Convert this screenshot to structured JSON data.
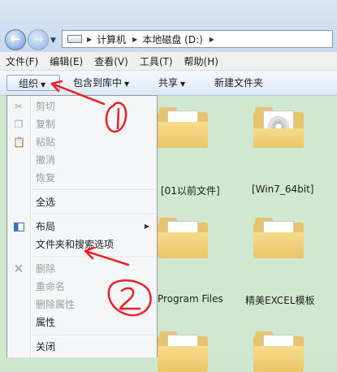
{
  "address": {
    "crumbs": [
      "计算机",
      "本地磁盘 (D:)"
    ]
  },
  "menubar": {
    "items": [
      "文件(F)",
      "编辑(E)",
      "查看(V)",
      "工具(T)",
      "帮助(H)"
    ]
  },
  "toolbar": {
    "organize": "组织",
    "include_library": "包含到库中",
    "share": "共享",
    "new_folder": "新建文件夹"
  },
  "dropdown": {
    "items": [
      {
        "label": "剪切",
        "icon": "scissors-icon",
        "disabled": true
      },
      {
        "label": "复制",
        "icon": "copy-icon",
        "disabled": true
      },
      {
        "label": "粘贴",
        "icon": "paste-icon",
        "disabled": true
      },
      {
        "label": "撤消",
        "disabled": true
      },
      {
        "label": "恢复",
        "disabled": true
      },
      {
        "label": "全选",
        "disabled": false
      },
      {
        "label": "布局",
        "icon": "layout-icon",
        "disabled": false,
        "submenu": true
      },
      {
        "label": "文件夹和搜索选项",
        "disabled": false
      },
      {
        "label": "删除",
        "icon": "delete-x-icon",
        "disabled": true
      },
      {
        "label": "重命名",
        "disabled": true
      },
      {
        "label": "删除属性",
        "disabled": true
      },
      {
        "label": "属性",
        "disabled": false
      },
      {
        "label": "关闭",
        "disabled": false
      }
    ]
  },
  "files": {
    "folders": [
      "[01以前文件]",
      "[Win7_64bit]",
      "Program Files",
      "精美EXCEL模板"
    ]
  },
  "colors": {
    "annotation": "#e8202a",
    "files_background": "#cfe8cf"
  }
}
